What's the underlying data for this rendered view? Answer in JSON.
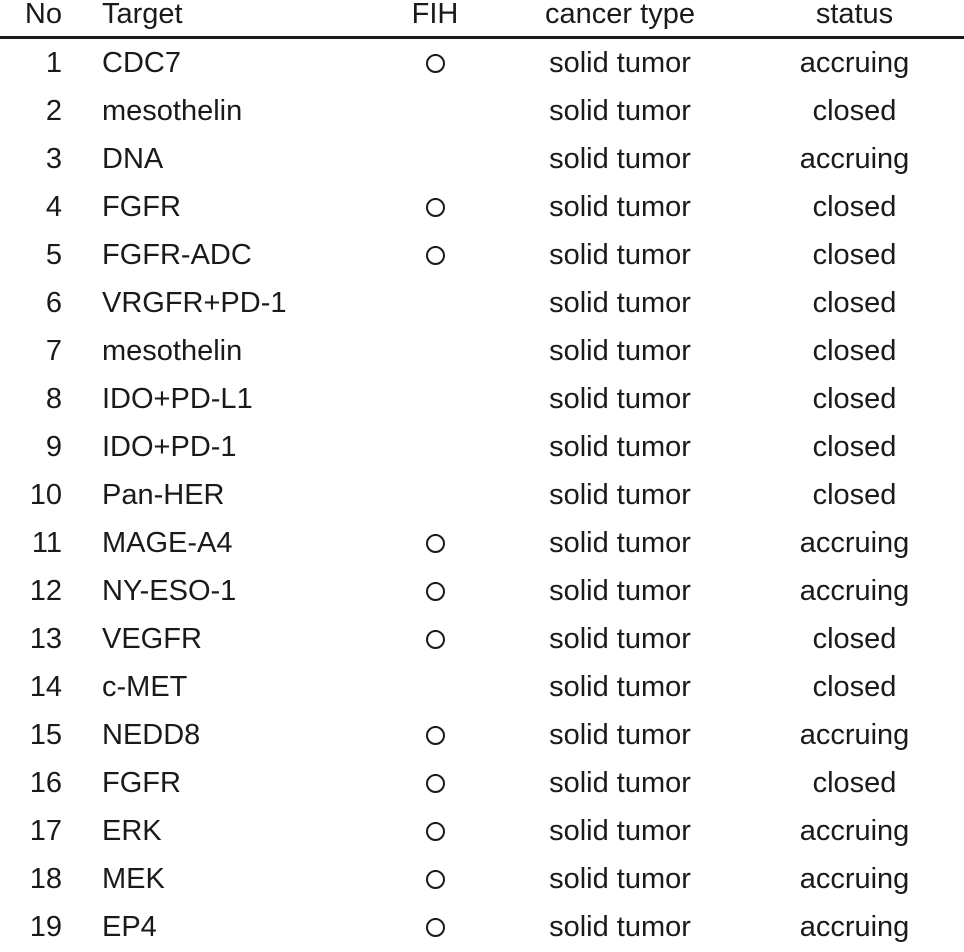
{
  "table": {
    "columns": [
      {
        "key": "no",
        "label": "No"
      },
      {
        "key": "target",
        "label": "Target"
      },
      {
        "key": "fih",
        "label": "FIH"
      },
      {
        "key": "cancer_type",
        "label": "cancer type"
      },
      {
        "key": "status",
        "label": "status"
      }
    ],
    "fih_marker_icon": "open-circle-icon",
    "rows": [
      {
        "no": "1",
        "target": "CDC7",
        "fih": "○",
        "cancer_type": "solid tumor",
        "status": "accruing"
      },
      {
        "no": "2",
        "target": "mesothelin",
        "fih": "",
        "cancer_type": "solid tumor",
        "status": "closed"
      },
      {
        "no": "3",
        "target": "DNA",
        "fih": "",
        "cancer_type": "solid tumor",
        "status": "accruing"
      },
      {
        "no": "4",
        "target": "FGFR",
        "fih": "○",
        "cancer_type": "solid tumor",
        "status": "closed"
      },
      {
        "no": "5",
        "target": "FGFR-ADC",
        "fih": "○",
        "cancer_type": "solid tumor",
        "status": "closed"
      },
      {
        "no": "6",
        "target": "VRGFR+PD-1",
        "fih": "",
        "cancer_type": "solid tumor",
        "status": "closed"
      },
      {
        "no": "7",
        "target": "mesothelin",
        "fih": "",
        "cancer_type": "solid tumor",
        "status": "closed"
      },
      {
        "no": "8",
        "target": "IDO+PD-L1",
        "fih": "",
        "cancer_type": "solid tumor",
        "status": "closed"
      },
      {
        "no": "9",
        "target": "IDO+PD-1",
        "fih": "",
        "cancer_type": "solid tumor",
        "status": "closed"
      },
      {
        "no": "10",
        "target": "Pan-HER",
        "fih": "",
        "cancer_type": "solid tumor",
        "status": "closed"
      },
      {
        "no": "11",
        "target": "MAGE-A4",
        "fih": "○",
        "cancer_type": "solid tumor",
        "status": "accruing"
      },
      {
        "no": "12",
        "target": "NY-ESO-1",
        "fih": "○",
        "cancer_type": "solid tumor",
        "status": "accruing"
      },
      {
        "no": "13",
        "target": "VEGFR",
        "fih": "○",
        "cancer_type": "solid tumor",
        "status": "closed"
      },
      {
        "no": "14",
        "target": "c-MET",
        "fih": "",
        "cancer_type": "solid tumor",
        "status": "closed"
      },
      {
        "no": "15",
        "target": "NEDD8",
        "fih": "○",
        "cancer_type": "solid tumor",
        "status": "accruing"
      },
      {
        "no": "16",
        "target": "FGFR",
        "fih": "○",
        "cancer_type": "solid tumor",
        "status": "closed"
      },
      {
        "no": "17",
        "target": "ERK",
        "fih": "○",
        "cancer_type": "solid tumor",
        "status": "accruing"
      },
      {
        "no": "18",
        "target": "MEK",
        "fih": "○",
        "cancer_type": "solid tumor",
        "status": "accruing"
      },
      {
        "no": "19",
        "target": "EP4",
        "fih": "○",
        "cancer_type": "solid tumor",
        "status": "accruing"
      }
    ]
  },
  "colors": {
    "text": "#1a1a1a",
    "background": "#ffffff",
    "rule": "#1a1a1a"
  }
}
